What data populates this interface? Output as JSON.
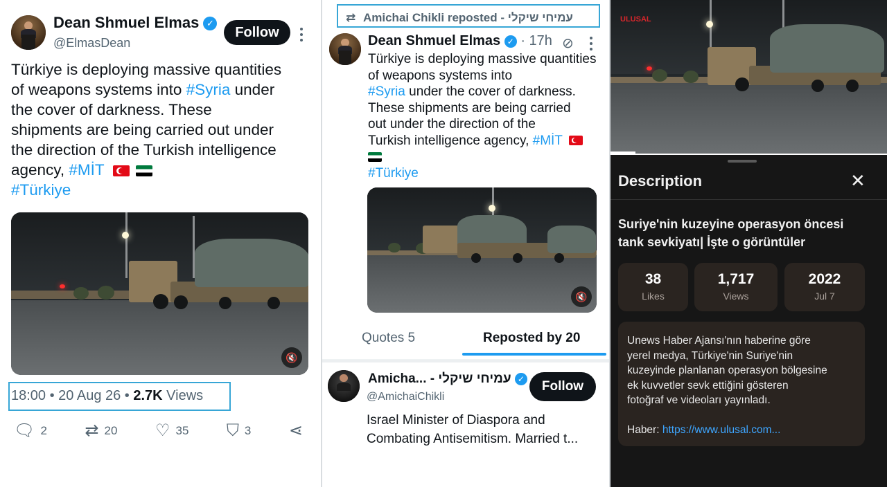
{
  "panel1": {
    "author_name": "Dean Shmuel Elmas",
    "handle": "@ElmasDean",
    "follow_label": "Follow",
    "tweet_line1": "Türkiye is deploying massive quantities",
    "tweet_line2_pre": "of weapons systems into ",
    "tweet_line2_tag": "#Syria",
    "tweet_line2_post": " under",
    "tweet_line3": "the cover of darkness. These",
    "tweet_line4": "shipments are being carried out under",
    "tweet_line5": "the direction of the Turkish intelligence",
    "tweet_line6_pre": "agency, ",
    "tweet_line6_tag": "#MİT",
    "tweet_line7_tag": "#Türkiye",
    "meta_time": "18:00 • 20 Aug 26 • ",
    "meta_views_count": "2.7K",
    "meta_views_label": " Views",
    "reply_count": "2",
    "repost_count": "20",
    "like_count": "35",
    "bookmark_count": "3"
  },
  "panel2": {
    "reposted_by": "Amichai Chikli reposted - עמיחי שיקלי",
    "author_name": "Dean Shmuel Elmas",
    "time": "· 17h",
    "tweet_line1": "Türkiye is deploying massive quantities",
    "tweet_line2_pre": "of weapons systems into",
    "tweet_line3_tag": "#Syria",
    "tweet_line3_post": " under the cover of darkness.",
    "tweet_line4": "These shipments are being carried",
    "tweet_line5": "out under the direction of the",
    "tweet_line6_pre": "Turkish intelligence agency, ",
    "tweet_line6_tag": "#MİT",
    "tweet_line8_tag": "#Türkiye",
    "tab_quotes": "Quotes 5",
    "tab_reposted": "Reposted by 20",
    "user_name": "Amicha... - עמיחי שיקלי",
    "user_handle": "@AmichaiChikli",
    "follow_label": "Follow",
    "bio_line1": "Israel Minister of Diaspora and",
    "bio_line2": "Combating Antisemitism. Married t..."
  },
  "panel3": {
    "watermark": "ULUSAL",
    "sheet_title": "Description",
    "video_title_line1": "Suriye'nin kuzeyine operasyon öncesi",
    "video_title_line2": "tank sevkiyatı| İşte o görüntüler",
    "stats": [
      {
        "num": "38",
        "label": "Likes"
      },
      {
        "num": "1,717",
        "label": "Views"
      },
      {
        "num": "2022",
        "label": "Jul 7"
      }
    ],
    "desc_line1": "Unews Haber Ajansı'nın haberine göre",
    "desc_line2": "yerel medya, Türkiye'nin Suriye'nin",
    "desc_line3": "kuzeyinde planlanan operasyon bölgesine",
    "desc_line4": "ek kuvvetler sevk ettiğini gösteren",
    "desc_line5": "fotoğraf ve videoları yayınladı.",
    "desc_source_label": "Haber: ",
    "desc_source_link": "https://www.ulusal.com..."
  }
}
